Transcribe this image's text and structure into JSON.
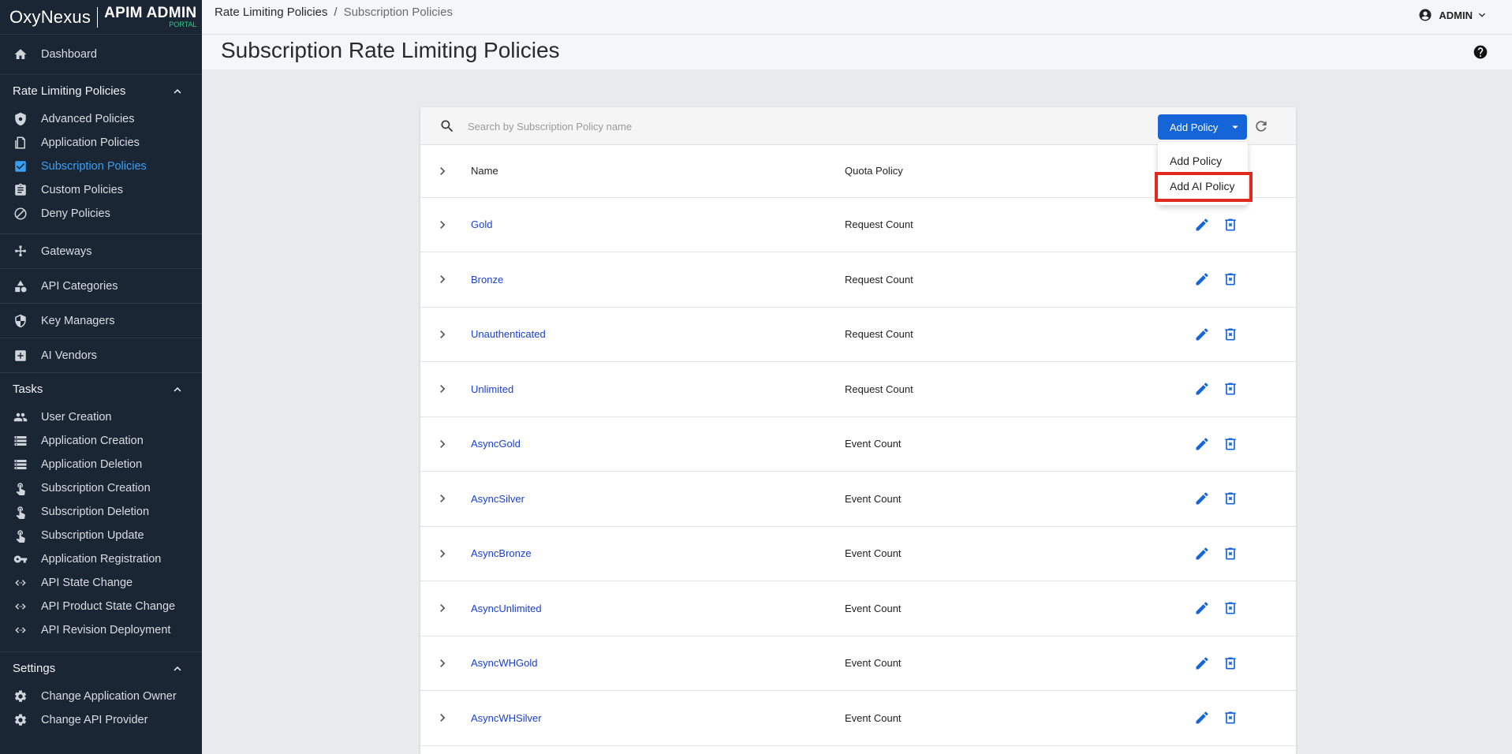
{
  "app": {
    "logo_text": "OxyNexus",
    "portal_title": "APIM ADMIN",
    "portal_sub": "PORTAL"
  },
  "sidebar": {
    "dashboard": "Dashboard",
    "rate_section": "Rate Limiting Policies",
    "rate_items": [
      "Advanced Policies",
      "Application Policies",
      "Subscription Policies",
      "Custom Policies",
      "Deny Policies"
    ],
    "gateways": "Gateways",
    "api_categories": "API Categories",
    "key_managers": "Key Managers",
    "ai_vendors": "AI Vendors",
    "tasks_section": "Tasks",
    "task_items": [
      "User Creation",
      "Application Creation",
      "Application Deletion",
      "Subscription Creation",
      "Subscription Deletion",
      "Subscription Update",
      "Application Registration",
      "API State Change",
      "API Product State Change",
      "API Revision Deployment"
    ],
    "settings_section": "Settings",
    "settings_items": [
      "Change Application Owner",
      "Change API Provider"
    ]
  },
  "header": {
    "breadcrumb_root": "Rate Limiting Policies",
    "breadcrumb_sep": "/",
    "breadcrumb_current": "Subscription Policies",
    "user": "ADMIN"
  },
  "page": {
    "title": "Subscription Rate Limiting Policies"
  },
  "toolbar": {
    "search_placeholder": "Search by Subscription Policy name",
    "add_button": "Add Policy"
  },
  "dropdown": {
    "items": [
      "Add Policy",
      "Add AI Policy"
    ]
  },
  "table": {
    "headers": {
      "name": "Name",
      "quota": "Quota Policy"
    },
    "rows": [
      {
        "name": "Gold",
        "quota": "Request Count"
      },
      {
        "name": "Bronze",
        "quota": "Request Count"
      },
      {
        "name": "Unauthenticated",
        "quota": "Request Count"
      },
      {
        "name": "Unlimited",
        "quota": "Request Count"
      },
      {
        "name": "AsyncGold",
        "quota": "Event Count"
      },
      {
        "name": "AsyncSilver",
        "quota": "Event Count"
      },
      {
        "name": "AsyncBronze",
        "quota": "Event Count"
      },
      {
        "name": "AsyncUnlimited",
        "quota": "Event Count"
      },
      {
        "name": "AsyncWHGold",
        "quota": "Event Count"
      },
      {
        "name": "AsyncWHSilver",
        "quota": "Event Count"
      }
    ]
  },
  "colors": {
    "sidebar_bg": "#1b2634",
    "active_nav": "#3aa0f5",
    "primary": "#1565d8",
    "highlight": "#e02a1d"
  }
}
